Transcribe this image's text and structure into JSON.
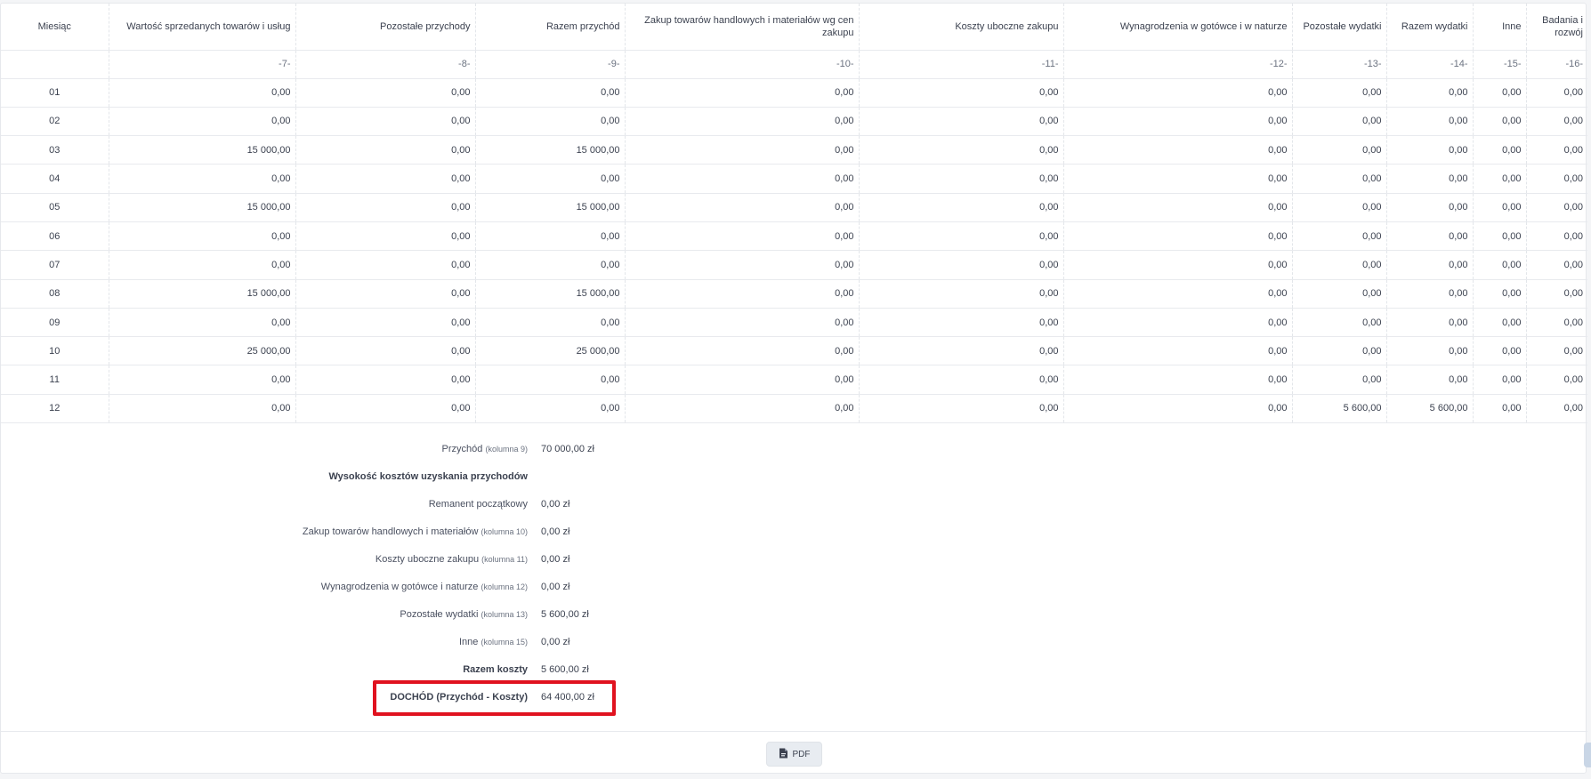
{
  "table": {
    "headers": [
      "Miesiąc",
      "Wartość sprzedanych towarów i usług",
      "Pozostałe przychody",
      "Razem przychód",
      "Zakup towarów handlowych i materiałów wg cen zakupu",
      "Koszty uboczne zakupu",
      "Wynagrodzenia w gotówce i w naturze",
      "Pozostałe wydatki",
      "Razem wydatki",
      "Inne",
      "Badania i rozwój"
    ],
    "column_numbers": [
      "",
      "-7-",
      "-8-",
      "-9-",
      "-10-",
      "-11-",
      "-12-",
      "-13-",
      "-14-",
      "-15-",
      "-16-"
    ],
    "rows": [
      [
        "01",
        "0,00",
        "0,00",
        "0,00",
        "0,00",
        "0,00",
        "0,00",
        "0,00",
        "0,00",
        "0,00",
        "0,00"
      ],
      [
        "02",
        "0,00",
        "0,00",
        "0,00",
        "0,00",
        "0,00",
        "0,00",
        "0,00",
        "0,00",
        "0,00",
        "0,00"
      ],
      [
        "03",
        "15 000,00",
        "0,00",
        "15 000,00",
        "0,00",
        "0,00",
        "0,00",
        "0,00",
        "0,00",
        "0,00",
        "0,00"
      ],
      [
        "04",
        "0,00",
        "0,00",
        "0,00",
        "0,00",
        "0,00",
        "0,00",
        "0,00",
        "0,00",
        "0,00",
        "0,00"
      ],
      [
        "05",
        "15 000,00",
        "0,00",
        "15 000,00",
        "0,00",
        "0,00",
        "0,00",
        "0,00",
        "0,00",
        "0,00",
        "0,00"
      ],
      [
        "06",
        "0,00",
        "0,00",
        "0,00",
        "0,00",
        "0,00",
        "0,00",
        "0,00",
        "0,00",
        "0,00",
        "0,00"
      ],
      [
        "07",
        "0,00",
        "0,00",
        "0,00",
        "0,00",
        "0,00",
        "0,00",
        "0,00",
        "0,00",
        "0,00",
        "0,00"
      ],
      [
        "08",
        "15 000,00",
        "0,00",
        "15 000,00",
        "0,00",
        "0,00",
        "0,00",
        "0,00",
        "0,00",
        "0,00",
        "0,00"
      ],
      [
        "09",
        "0,00",
        "0,00",
        "0,00",
        "0,00",
        "0,00",
        "0,00",
        "0,00",
        "0,00",
        "0,00",
        "0,00"
      ],
      [
        "10",
        "25 000,00",
        "0,00",
        "25 000,00",
        "0,00",
        "0,00",
        "0,00",
        "0,00",
        "0,00",
        "0,00",
        "0,00"
      ],
      [
        "11",
        "0,00",
        "0,00",
        "0,00",
        "0,00",
        "0,00",
        "0,00",
        "0,00",
        "0,00",
        "0,00",
        "0,00"
      ],
      [
        "12",
        "0,00",
        "0,00",
        "0,00",
        "0,00",
        "0,00",
        "0,00",
        "5 600,00",
        "5 600,00",
        "0,00",
        "0,00"
      ]
    ]
  },
  "summary": {
    "przychod_label": "Przychód",
    "przychod_col": "(kolumna 9)",
    "przychod_value": "70 000,00 zł",
    "costs_heading": "Wysokość kosztów uzyskania przychodów",
    "remanent_label": "Remanent początkowy",
    "remanent_value": "0,00 zł",
    "zakup_label": "Zakup towarów handlowych i materiałów",
    "zakup_col": "(kolumna 10)",
    "zakup_value": "0,00 zł",
    "uboczne_label": "Koszty uboczne zakupu",
    "uboczne_col": "(kolumna 11)",
    "uboczne_value": "0,00 zł",
    "wynagrodzenia_label": "Wynagrodzenia w gotówce i naturze",
    "wynagrodzenia_col": "(kolumna 12)",
    "wynagrodzenia_value": "0,00 zł",
    "pozostale_label": "Pozostałe wydatki",
    "pozostale_col": "(kolumna 13)",
    "pozostale_value": "5 600,00 zł",
    "inne_label": "Inne",
    "inne_col": "(kolumna 15)",
    "inne_value": "0,00 zł",
    "razem_label": "Razem koszty",
    "razem_value": "5 600,00 zł",
    "dochod_label": "DOCHÓD (Przychód - Koszty)",
    "dochod_value": "64 400,00 zł"
  },
  "footer": {
    "pdf_label": "PDF",
    "pdf_icon": "pdf-file-icon"
  },
  "colors": {
    "highlight": "#e0121f",
    "button_bg": "#e8ecf1"
  }
}
